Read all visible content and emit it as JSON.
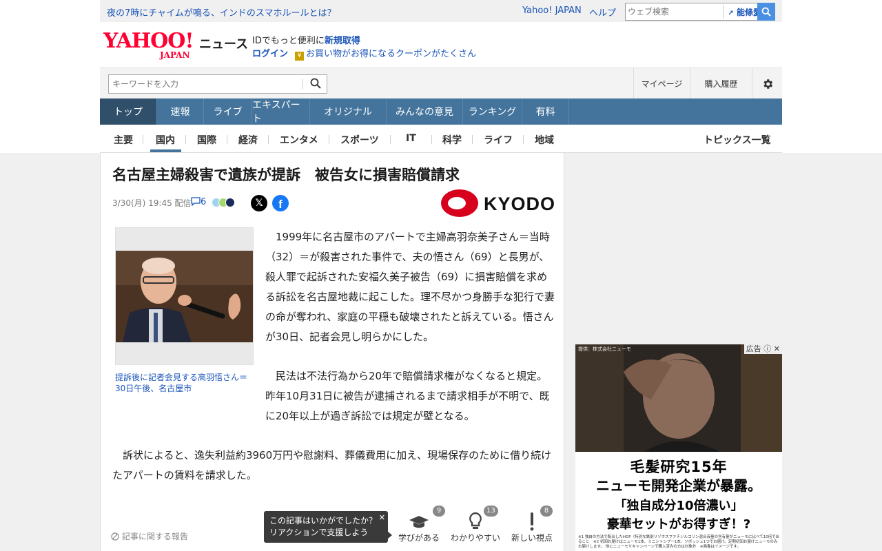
{
  "top_bar": {
    "headline": "夜の7時にチャイムが鳴る、インドのスマホルールとは？",
    "yahoo_japan": "Yahoo! JAPAN",
    "help": "ヘルプ",
    "web_search_placeholder": "ウェブ検索",
    "trend_keyword": "能條愛未"
  },
  "brand": {
    "logo_main": "YAHOO!",
    "logo_sub": "JAPAN",
    "service": "ニュース",
    "promo_prefix": "IDでもっと便利に",
    "promo_link": "新規取得",
    "login": "ログイン",
    "coupon": "お買い物がお得になるクーポンがたくさん"
  },
  "search": {
    "placeholder": "キーワードを入力",
    "mypage": "マイページ",
    "history": "購入履歴"
  },
  "main_nav": [
    "トップ",
    "速報",
    "ライブ",
    "エキスパート",
    "オリジナル",
    "みんなの意見",
    "ランキング",
    "有料"
  ],
  "sub_nav": [
    "主要",
    "国内",
    "国際",
    "経済",
    "エンタメ",
    "スポーツ",
    "IT",
    "科学",
    "ライフ",
    "地域"
  ],
  "topics_all": "トピックス一覧",
  "article": {
    "title": "名古屋主婦殺害で遺族が提訴　被告女に損害賠償請求",
    "date": "3/30(月) 19:45",
    "delivered": "配信",
    "comment_count": "6",
    "source": "KYODO",
    "caption": "提訴後に記者会見する高羽悟さん＝30日午後、名古屋市",
    "paragraph1": "　1999年に名古屋市のアパートで主婦高羽奈美子さん＝当時（32）＝が殺害された事件で、夫の悟さん（69）と長男が、殺人罪で起訴された安福久美子被告（69）に損害賠償を求める訴訟を名古屋地裁に起こした。理不尽かつ身勝手な犯行で妻の命が奪われ、家庭の平穏も破壊されたと訴えている。悟さんが30日、記者会見し明らかにした。",
    "paragraph2": "　民法は不法行為から20年で賠償請求権がなくなると規定。昨年10月31日に被告が逮捕されるまで請求相手が不明で、既に20年以上が過ぎ訴訟では規定が壁となる。",
    "paragraph3": "　訴状によると、逸失利益約3960万円や慰謝料、葬儀費用に加え、現場保存のために借り続けたアパートの賃料を請求した。",
    "report": "記事に関する報告"
  },
  "reaction": {
    "prompt_line1": "この記事はいかがでしたか？",
    "prompt_line2": "リアクションで支援しよう",
    "close": "✕",
    "items": [
      {
        "label": "学びがある",
        "count": "9"
      },
      {
        "label": "わかりやすい",
        "count": "13"
      },
      {
        "label": "新しい視点",
        "count": "8"
      }
    ]
  },
  "ad": {
    "label": "広告",
    "provider": "提供：株式会社ニューモ",
    "line1": "毛髪研究15年",
    "line2": "ニューモ開発企業が暴露。",
    "line3": "「独自成分10倍濃い」",
    "line4": "豪華セットがお得すぎ！?",
    "fine_print": "※1 独自の方法で配合したHGP（特別な鉄剤リゾホスファチジルコリン混合液量の含有量がニューモに比べて10倍であること　※2 初回お届けはニューモ1本、ミニシャンプー1本、ツボッシュ1つでお届け。定期初回お届けニューモのみお届けします。 他にニューモＶキャンペーンで購入済みの方は対象外　※画像はイメージです。"
  },
  "colors": {
    "nav_blue": "#44749c",
    "nav_active": "#2f4f6b",
    "link_blue": "#1a55b8",
    "yahoo_red": "#ff0033",
    "kyodo_red": "#d7001d"
  }
}
